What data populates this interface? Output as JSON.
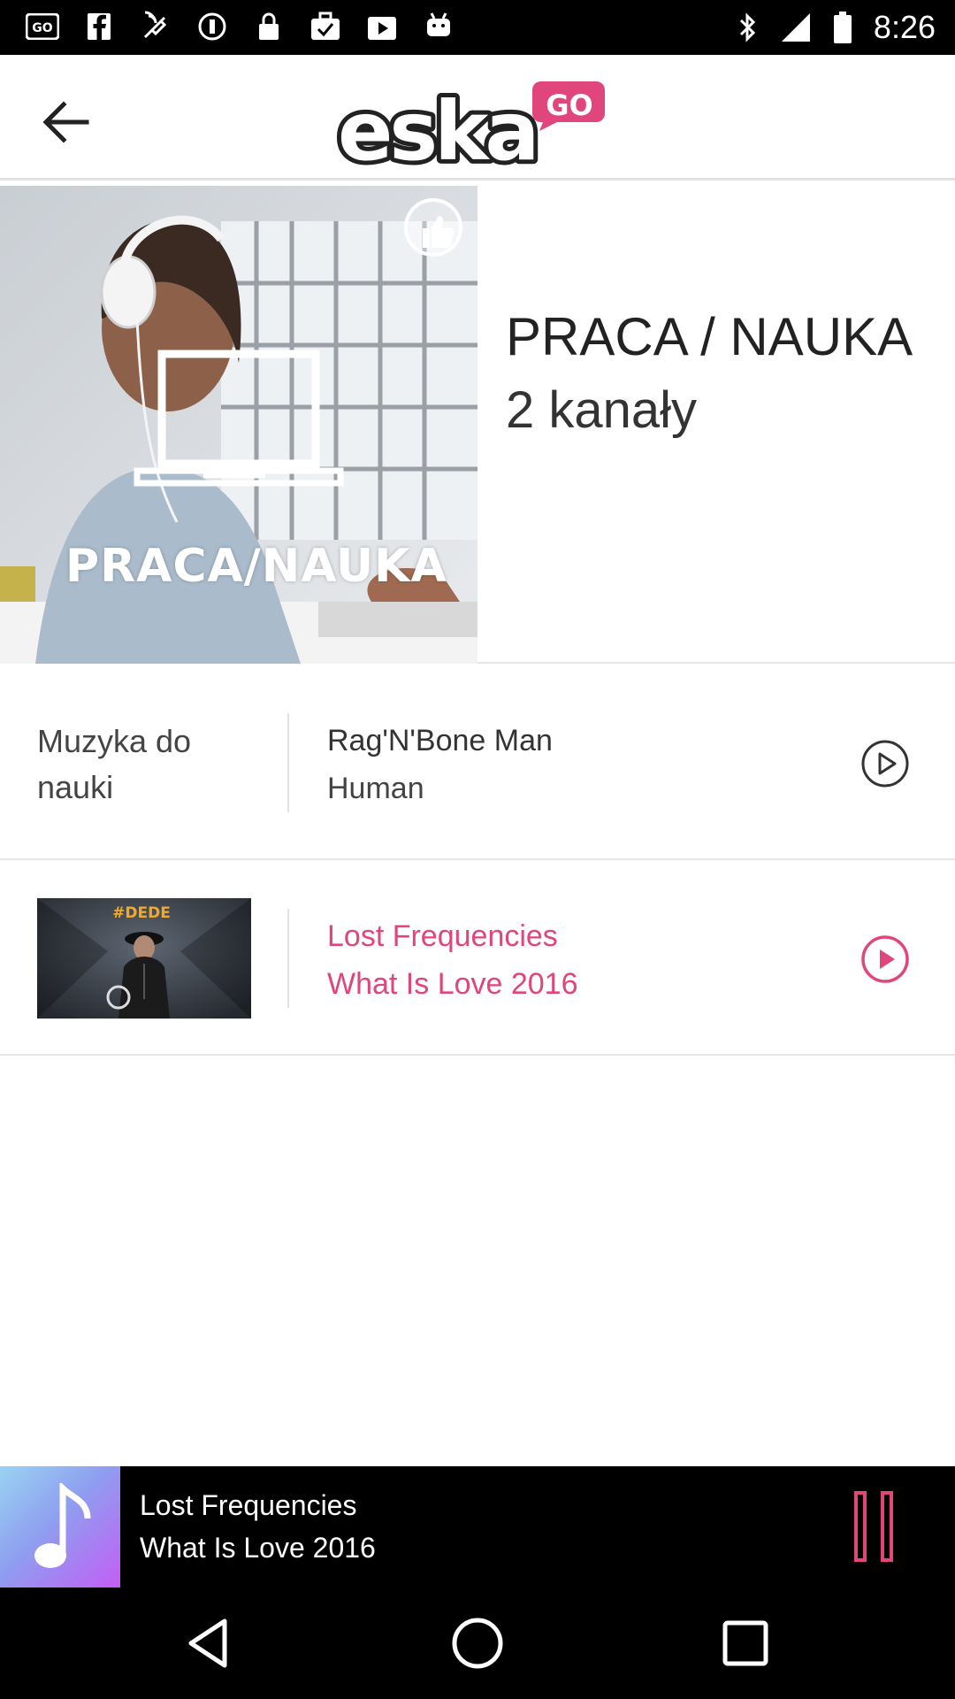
{
  "status_bar": {
    "time": "8:26",
    "icons": [
      "go-app-icon",
      "facebook-icon",
      "fake-gps-icon",
      "blocked-icon",
      "lock-icon",
      "check-briefcase-icon",
      "play-store-icon",
      "android-icon"
    ],
    "right_icons": [
      "bluetooth-icon",
      "signal-icon",
      "battery-icon"
    ]
  },
  "header": {
    "logo_text": "eska",
    "logo_badge": "GO"
  },
  "hero": {
    "image_label": "PRACA/NAUKA",
    "title": "PRACA / NAUKA",
    "subtitle": "2 kanały"
  },
  "channels": [
    {
      "name": "Muzyka do nauki",
      "artist": "Rag'N'Bone Man",
      "track": "Human",
      "active": false
    },
    {
      "thumb_label": "#DEDE",
      "artist": "Lost Frequencies",
      "track": "What Is Love 2016",
      "active": true
    }
  ],
  "now_playing": {
    "artist": "Lost Frequencies",
    "track": "What Is Love 2016"
  },
  "colors": {
    "accent": "#e0457b",
    "status_bar": "#000000"
  }
}
